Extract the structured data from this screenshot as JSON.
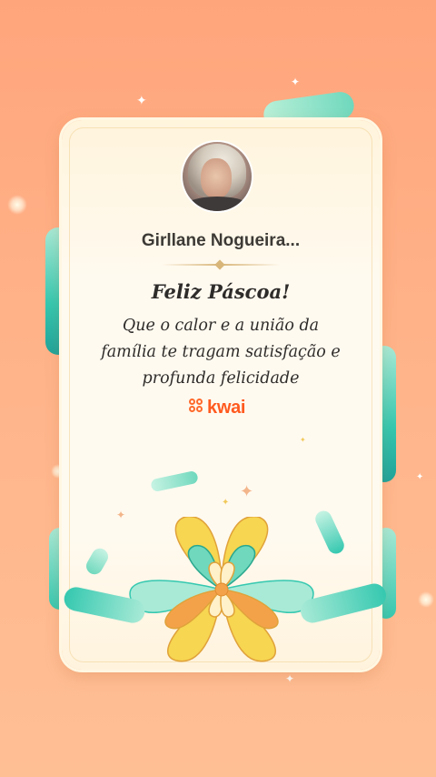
{
  "card": {
    "username": "Girllane Nogueira...",
    "title": "Feliz Páscoa!",
    "message_lines": [
      "Que o calor e a união da",
      "família te tragam satisfação e",
      "profunda felicidade"
    ],
    "brand": "kwai"
  },
  "colors": {
    "background_top": "#ffa57c",
    "background_bottom": "#ffbf95",
    "card": "#fffaf0",
    "ribbon_teal": "#35c8b0",
    "ribbon_mint": "#a8ead6",
    "petal_yellow": "#f7d651",
    "petal_orange": "#f4a24a",
    "brand_orange": "#ff5a1f"
  },
  "icons": {
    "avatar": "profile-photo",
    "brand_logo": "kwai-logo-icon",
    "decorations": [
      "sparkle-icon",
      "flower-bow-icon",
      "ribbon"
    ]
  }
}
